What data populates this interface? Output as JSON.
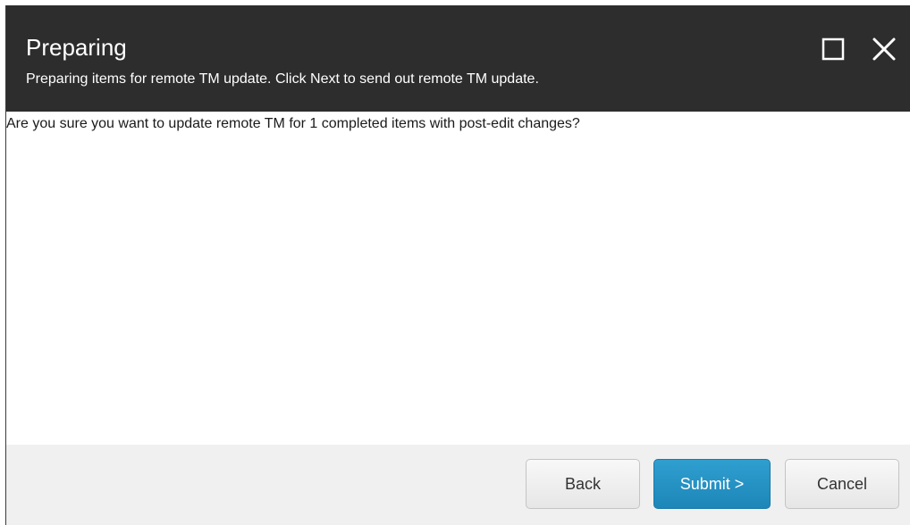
{
  "dialog": {
    "title": "Preparing",
    "subtitle": "Preparing items for remote TM update. Click Next to send out remote TM update.",
    "message": "Are you sure you want to update remote TM for 1 completed items with post-edit changes?",
    "window_controls": {
      "maximize_icon": "maximize-icon",
      "close_icon": "close-icon"
    },
    "buttons": {
      "back": "Back",
      "submit": "Submit >",
      "cancel": "Cancel"
    },
    "colors": {
      "header_bg": "#2d2d2d",
      "primary_button": "#2596c8",
      "footer_bg": "#f0f0f0"
    }
  }
}
